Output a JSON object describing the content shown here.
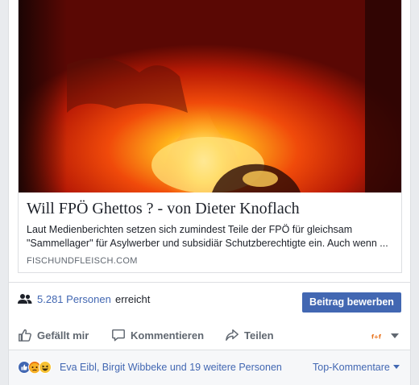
{
  "link_preview": {
    "title": "Will FPÖ Ghettos ? - von Dieter Knoflach",
    "description": "Laut Medienberichten setzen sich zumindest Teile der FPÖ für gleichsam \"Sammellager\" für Asylwerber und subsidiär Schutzberechtigte ein. Auch wenn ...",
    "domain": "FISCHUNDFLEISCH.COM"
  },
  "reach": {
    "count": "5.281 Personen",
    "suffix": "erreicht",
    "boost_label": "Beitrag bewerben"
  },
  "actions": {
    "like_label": "Gefällt mir",
    "comment_label": "Kommentieren",
    "share_label": "Teilen"
  },
  "reactions": {
    "names": "Eva Eibl, Birgit Wibbeke und 19 weitere Personen",
    "sort_label": "Top-Kommentare",
    "icons": [
      "like-reaction-icon",
      "angry-reaction-icon",
      "haha-reaction-icon"
    ]
  },
  "colors": {
    "accent": "#4267b2",
    "muted": "#606770",
    "border": "#dddfe2"
  }
}
